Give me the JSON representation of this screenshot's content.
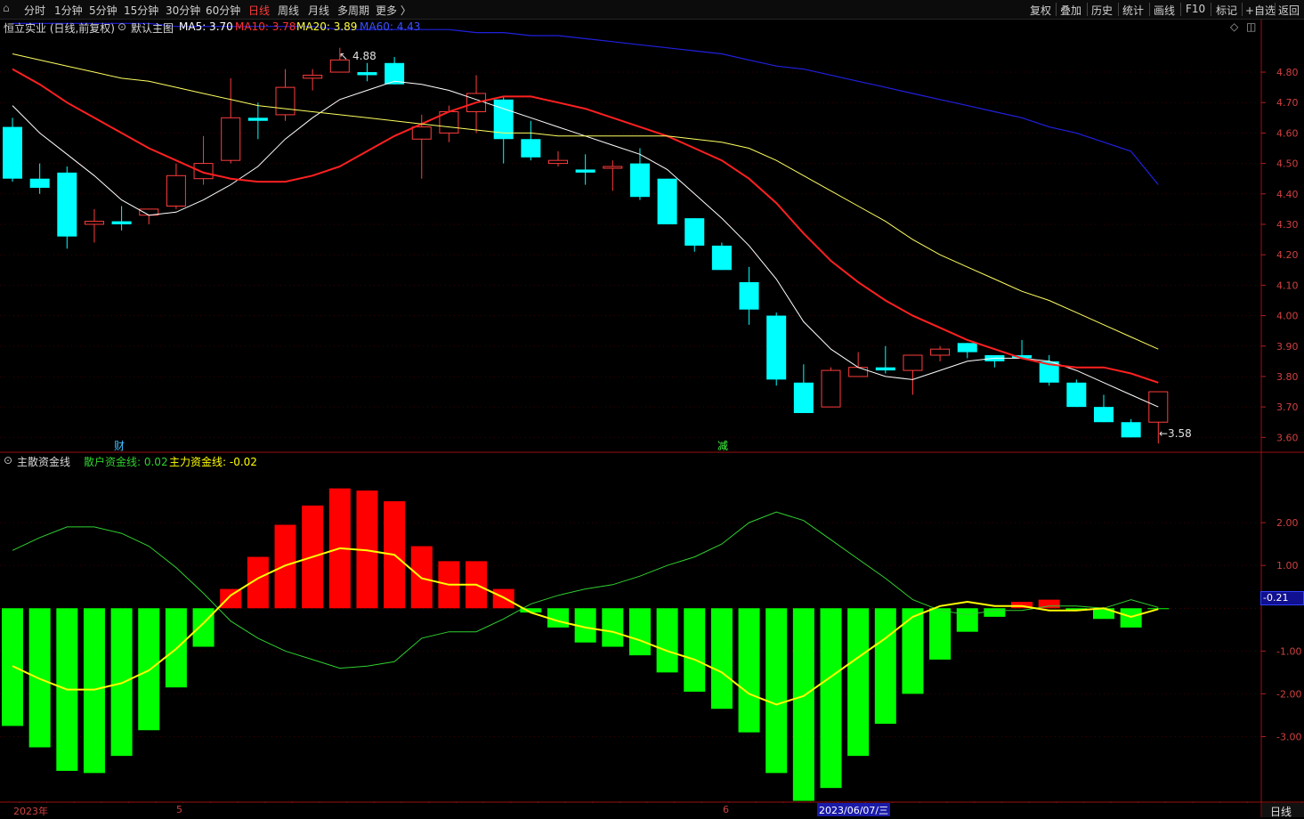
{
  "toolbar": {
    "periods": [
      "分时",
      "1分钟",
      "5分钟",
      "15分钟",
      "30分钟",
      "60分钟",
      "日线",
      "周线",
      "月线",
      "多周期",
      "更多 〉"
    ],
    "active_period": "日线",
    "right": [
      "复权",
      "叠加",
      "历史",
      "统计",
      "画线",
      "F10",
      "标记",
      "+自选",
      "返回"
    ]
  },
  "main_info": {
    "stock": "恒立实业 (日线,前复权)",
    "template": "默认主图",
    "ma5_label": "MA5: 3.70",
    "ma10_label": "MA10: 3.78",
    "ma20_label": "MA20: 3.89",
    "ma60_label": "MA60: 4.43"
  },
  "indicator_info": {
    "name": "主散资金线",
    "retail_label": "散户资金线: 0.02",
    "main_label": "主力资金线: -0.02"
  },
  "annotations": {
    "high_label": "4.88",
    "low_label": "←3.58",
    "cai_tag": "财",
    "jian_tag": "减",
    "current_value": "-0.21"
  },
  "date_axis": {
    "labels": [
      "2023年",
      "5",
      "6"
    ],
    "cursor_date": "2023/06/07/三",
    "period_button": "日线"
  },
  "colors": {
    "up": "#ff3c3c",
    "down": "#00ffff",
    "ma5": "#ffffff",
    "ma10": "#ff2020",
    "ma20": "#ffff60",
    "ma60": "#2020e0",
    "positive_bar": "#ff0000",
    "negative_bar": "#00ff00",
    "retail_line": "#30d030",
    "main_line": "#ffff00"
  },
  "chart_data": [
    {
      "type": "candlestick",
      "title": "恒立实业 (日线,前复权)",
      "y_ticks": [
        "4.80",
        "4.70",
        "4.60",
        "4.50",
        "4.40",
        "4.30",
        "4.20",
        "4.10",
        "4.00",
        "3.90",
        "3.80",
        "3.70",
        "3.60"
      ],
      "ylim": [
        3.56,
        4.92
      ],
      "candles": [
        {
          "o": 4.62,
          "h": 4.65,
          "l": 4.44,
          "c": 4.45
        },
        {
          "o": 4.45,
          "h": 4.5,
          "l": 4.4,
          "c": 4.42
        },
        {
          "o": 4.47,
          "h": 4.49,
          "l": 4.22,
          "c": 4.26
        },
        {
          "o": 4.3,
          "h": 4.35,
          "l": 4.24,
          "c": 4.31
        },
        {
          "o": 4.31,
          "h": 4.36,
          "l": 4.28,
          "c": 4.3
        },
        {
          "o": 4.33,
          "h": 4.35,
          "l": 4.3,
          "c": 4.35
        },
        {
          "o": 4.36,
          "h": 4.5,
          "l": 4.35,
          "c": 4.46
        },
        {
          "o": 4.45,
          "h": 4.59,
          "l": 4.43,
          "c": 4.5
        },
        {
          "o": 4.51,
          "h": 4.78,
          "l": 4.5,
          "c": 4.65
        },
        {
          "o": 4.65,
          "h": 4.7,
          "l": 4.58,
          "c": 4.64
        },
        {
          "o": 4.66,
          "h": 4.81,
          "l": 4.64,
          "c": 4.75
        },
        {
          "o": 4.78,
          "h": 4.81,
          "l": 4.74,
          "c": 4.79
        },
        {
          "o": 4.8,
          "h": 4.88,
          "l": 4.8,
          "c": 4.84
        },
        {
          "o": 4.8,
          "h": 4.83,
          "l": 4.77,
          "c": 4.79
        },
        {
          "o": 4.83,
          "h": 4.85,
          "l": 4.76,
          "c": 4.76
        },
        {
          "o": 4.58,
          "h": 4.66,
          "l": 4.45,
          "c": 4.62
        },
        {
          "o": 4.6,
          "h": 4.69,
          "l": 4.57,
          "c": 4.67
        },
        {
          "o": 4.67,
          "h": 4.79,
          "l": 4.6,
          "c": 4.73
        },
        {
          "o": 4.71,
          "h": 4.72,
          "l": 4.5,
          "c": 4.58
        },
        {
          "o": 4.58,
          "h": 4.64,
          "l": 4.51,
          "c": 4.52
        },
        {
          "o": 4.5,
          "h": 4.54,
          "l": 4.49,
          "c": 4.51
        },
        {
          "o": 4.48,
          "h": 4.53,
          "l": 4.43,
          "c": 4.47
        },
        {
          "o": 4.49,
          "h": 4.51,
          "l": 4.41,
          "c": 4.49
        },
        {
          "o": 4.5,
          "h": 4.55,
          "l": 4.38,
          "c": 4.39
        },
        {
          "o": 4.45,
          "h": 4.45,
          "l": 4.3,
          "c": 4.3
        },
        {
          "o": 4.32,
          "h": 4.32,
          "l": 4.21,
          "c": 4.23
        },
        {
          "o": 4.23,
          "h": 4.24,
          "l": 4.15,
          "c": 4.15
        },
        {
          "o": 4.11,
          "h": 4.16,
          "l": 3.97,
          "c": 4.02
        },
        {
          "o": 4.0,
          "h": 4.01,
          "l": 3.77,
          "c": 3.79
        },
        {
          "o": 3.78,
          "h": 3.84,
          "l": 3.68,
          "c": 3.68
        },
        {
          "o": 3.7,
          "h": 3.83,
          "l": 3.7,
          "c": 3.82
        },
        {
          "o": 3.8,
          "h": 3.88,
          "l": 3.8,
          "c": 3.83
        },
        {
          "o": 3.83,
          "h": 3.9,
          "l": 3.81,
          "c": 3.82
        },
        {
          "o": 3.82,
          "h": 3.87,
          "l": 3.74,
          "c": 3.87
        },
        {
          "o": 3.87,
          "h": 3.9,
          "l": 3.85,
          "c": 3.89
        },
        {
          "o": 3.91,
          "h": 3.91,
          "l": 3.86,
          "c": 3.88
        },
        {
          "o": 3.87,
          "h": 3.87,
          "l": 3.83,
          "c": 3.85
        },
        {
          "o": 3.87,
          "h": 3.92,
          "l": 3.86,
          "c": 3.86
        },
        {
          "o": 3.85,
          "h": 3.87,
          "l": 3.77,
          "c": 3.78
        },
        {
          "o": 3.78,
          "h": 3.79,
          "l": 3.7,
          "c": 3.7
        },
        {
          "o": 3.7,
          "h": 3.74,
          "l": 3.65,
          "c": 3.65
        },
        {
          "o": 3.65,
          "h": 3.66,
          "l": 3.6,
          "c": 3.6
        },
        {
          "o": 3.65,
          "h": 3.75,
          "l": 3.58,
          "c": 3.75
        }
      ],
      "series": [
        {
          "name": "MA5",
          "values": [
            4.69,
            4.6,
            4.53,
            4.46,
            4.38,
            4.33,
            4.34,
            4.38,
            4.43,
            4.49,
            4.58,
            4.65,
            4.71,
            4.74,
            4.77,
            4.76,
            4.74,
            4.71,
            4.68,
            4.65,
            4.62,
            4.59,
            4.56,
            4.53,
            4.48,
            4.4,
            4.32,
            4.23,
            4.12,
            3.98,
            3.89,
            3.83,
            3.8,
            3.79,
            3.82,
            3.85,
            3.86,
            3.86,
            3.85,
            3.82,
            3.78,
            3.74,
            3.7
          ]
        },
        {
          "name": "MA10",
          "values": [
            4.81,
            4.76,
            4.7,
            4.65,
            4.6,
            4.55,
            4.51,
            4.47,
            4.45,
            4.44,
            4.44,
            4.46,
            4.49,
            4.54,
            4.59,
            4.63,
            4.67,
            4.7,
            4.72,
            4.72,
            4.7,
            4.68,
            4.65,
            4.62,
            4.59,
            4.55,
            4.51,
            4.45,
            4.37,
            4.27,
            4.18,
            4.11,
            4.05,
            4.0,
            3.96,
            3.92,
            3.89,
            3.86,
            3.84,
            3.83,
            3.83,
            3.81,
            3.78
          ]
        },
        {
          "name": "MA20",
          "values": [
            4.86,
            4.84,
            4.82,
            4.8,
            4.78,
            4.77,
            4.75,
            4.73,
            4.71,
            4.69,
            4.68,
            4.67,
            4.66,
            4.65,
            4.64,
            4.63,
            4.62,
            4.61,
            4.6,
            4.6,
            4.59,
            4.59,
            4.59,
            4.59,
            4.59,
            4.58,
            4.57,
            4.55,
            4.51,
            4.46,
            4.41,
            4.36,
            4.31,
            4.25,
            4.2,
            4.16,
            4.12,
            4.08,
            4.05,
            4.01,
            3.97,
            3.93,
            3.89
          ]
        },
        {
          "name": "MA60",
          "values": [
            4.96,
            4.96,
            4.96,
            4.96,
            4.96,
            4.96,
            4.95,
            4.95,
            4.95,
            4.95,
            4.95,
            4.95,
            4.94,
            4.94,
            4.94,
            4.94,
            4.94,
            4.93,
            4.93,
            4.92,
            4.92,
            4.91,
            4.9,
            4.89,
            4.88,
            4.87,
            4.86,
            4.84,
            4.82,
            4.81,
            4.79,
            4.77,
            4.75,
            4.73,
            4.71,
            4.69,
            4.67,
            4.65,
            4.62,
            4.6,
            4.57,
            4.54,
            4.43
          ]
        }
      ]
    },
    {
      "type": "bar",
      "title": "主散资金线",
      "y_ticks": [
        "2.00",
        "1.00",
        "-1.00",
        "-2.00",
        "-3.00"
      ],
      "ylim": [
        -4.55,
        3.25
      ],
      "values": [
        -2.75,
        -3.25,
        -3.8,
        -3.85,
        -3.45,
        -2.85,
        -1.85,
        -0.9,
        0.45,
        1.2,
        1.95,
        2.4,
        2.8,
        2.75,
        2.5,
        1.45,
        1.1,
        1.1,
        0.45,
        -0.1,
        -0.45,
        -0.8,
        -0.9,
        -1.1,
        -1.5,
        -1.95,
        -2.35,
        -2.9,
        -3.85,
        -4.5,
        -4.2,
        -3.45,
        -2.7,
        -2.0,
        -1.2,
        -0.55,
        -0.2,
        0.15,
        0.2,
        -0.05,
        -0.25,
        -0.45,
        -0.02
      ],
      "series": [
        {
          "name": "散户资金线",
          "values": [
            1.35,
            1.65,
            1.9,
            1.9,
            1.75,
            1.45,
            0.95,
            0.35,
            -0.3,
            -0.7,
            -1.0,
            -1.2,
            -1.4,
            -1.35,
            -1.25,
            -0.7,
            -0.55,
            -0.55,
            -0.25,
            0.1,
            0.3,
            0.45,
            0.55,
            0.75,
            1.0,
            1.2,
            1.5,
            2.0,
            2.25,
            2.05,
            1.6,
            1.15,
            0.7,
            0.2,
            -0.05,
            -0.15,
            -0.05,
            -0.05,
            0.05,
            0.05,
            0.0,
            0.2,
            0.02
          ]
        },
        {
          "name": "主力资金线",
          "values": [
            -1.35,
            -1.65,
            -1.9,
            -1.9,
            -1.75,
            -1.45,
            -0.95,
            -0.35,
            0.3,
            0.7,
            1.0,
            1.2,
            1.4,
            1.35,
            1.25,
            0.7,
            0.55,
            0.55,
            0.25,
            -0.1,
            -0.3,
            -0.45,
            -0.55,
            -0.75,
            -1.0,
            -1.2,
            -1.5,
            -2.0,
            -2.25,
            -2.05,
            -1.6,
            -1.15,
            -0.7,
            -0.2,
            0.05,
            0.15,
            0.05,
            0.05,
            -0.05,
            -0.05,
            0.0,
            -0.2,
            -0.02
          ]
        }
      ]
    }
  ]
}
